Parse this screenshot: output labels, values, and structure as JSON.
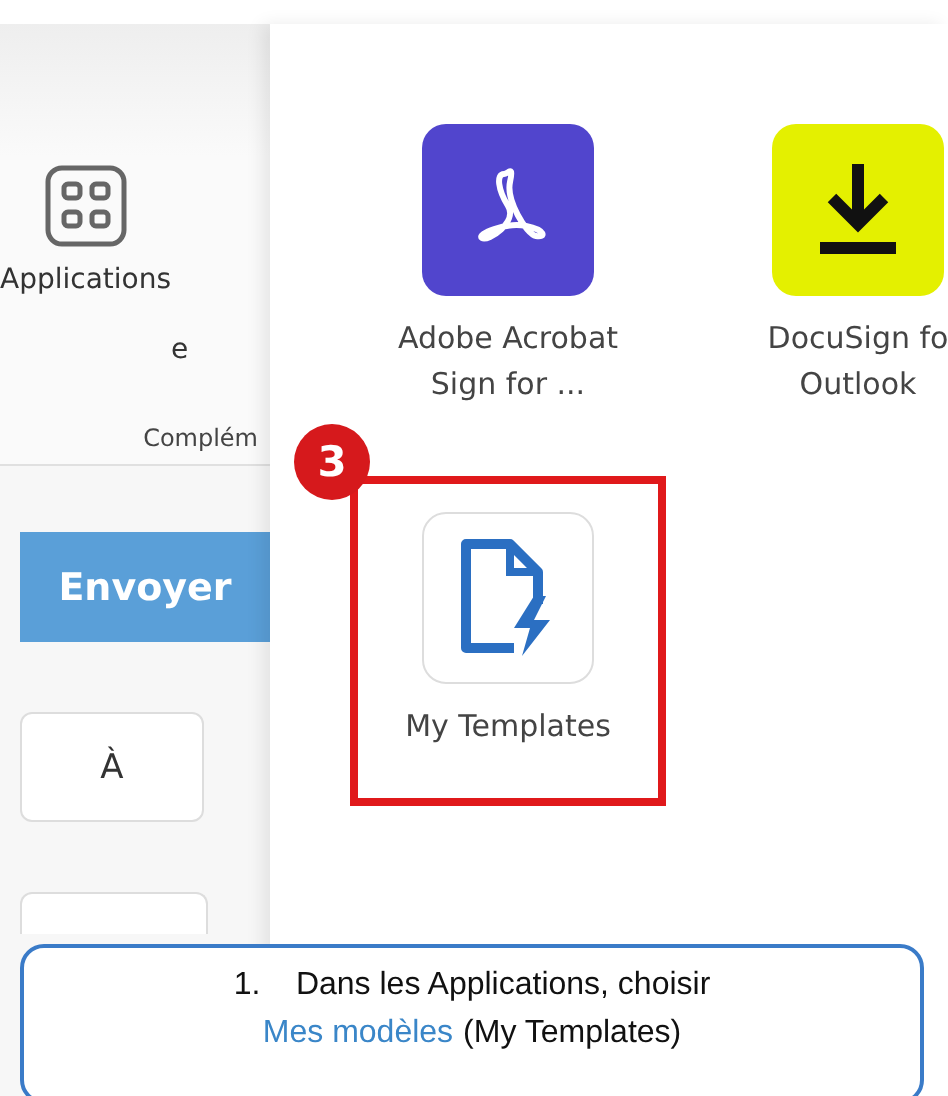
{
  "ribbon": {
    "button": "Applications",
    "cut_label": "e",
    "group_label": "Complém"
  },
  "send_button": "Envoyer",
  "recipient_buttons": [
    "À"
  ],
  "apps": [
    {
      "kind": "acrobat",
      "lines": [
        "Adobe Acrobat",
        "Sign for ..."
      ],
      "highlighted": false
    },
    {
      "kind": "docusign",
      "lines": [
        "DocuSign fo",
        "Outlook"
      ],
      "highlighted": false
    },
    {
      "kind": "templates",
      "lines": [
        "My Templates"
      ],
      "highlighted": true,
      "badge": "3"
    }
  ],
  "callout": {
    "number": "1.",
    "text": "Dans les Applications, choisir",
    "link": "Mes modèles",
    "after": "(My Templates)"
  }
}
